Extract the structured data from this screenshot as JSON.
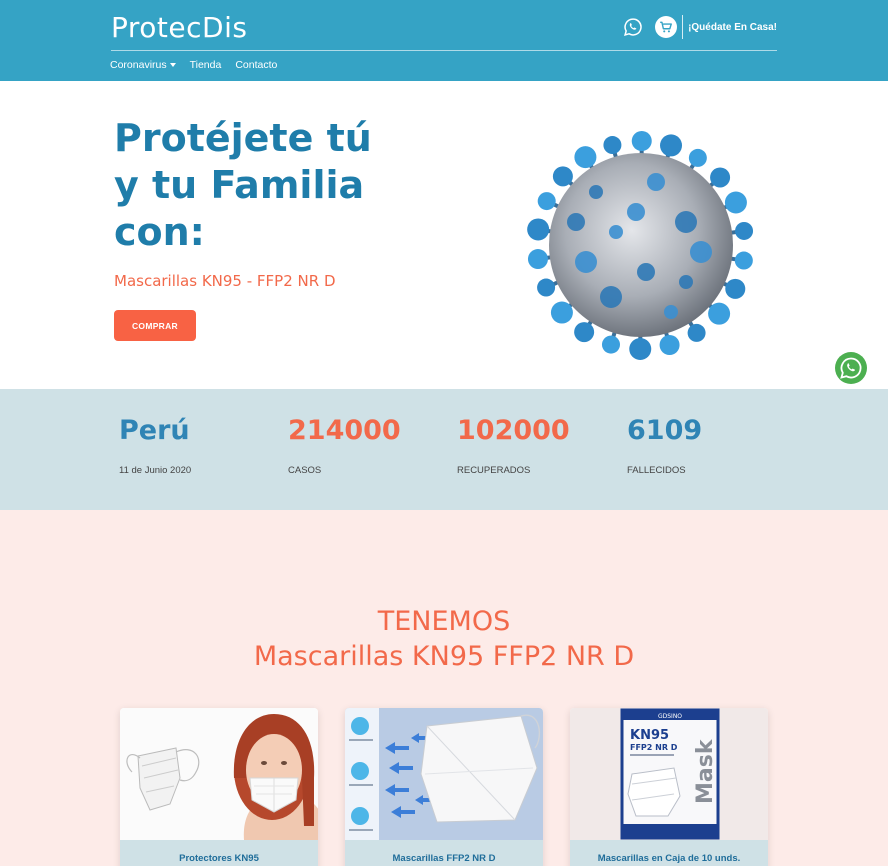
{
  "header": {
    "brand": "ProtecDis",
    "stay_home": "¡Quédate En Casa!",
    "nav": [
      "Coronavirus",
      "Tienda",
      "Contacto"
    ]
  },
  "hero": {
    "title_lines": [
      "Protéjete tú",
      "y tu Familia",
      "con:"
    ],
    "subtitle": "Mascarillas KN95 - FFP2 NR D",
    "button": "COMPRAR"
  },
  "stats": {
    "country": "Perú",
    "date": "11 de Junio 2020",
    "items": [
      {
        "value": "214000",
        "label": "CASOS"
      },
      {
        "value": "102000",
        "label": "RECUPERADOS"
      },
      {
        "value": "6109",
        "label": "FALLECIDOS"
      }
    ]
  },
  "products": {
    "title_lines": [
      "TENEMOS",
      "Mascarillas KN95 FFP2 NR D"
    ],
    "cards": [
      {
        "caption": "Protectores KN95"
      },
      {
        "caption": "Mascarillas FFP2 NR D"
      },
      {
        "caption": "Mascarillas en Caja de 10 unds.",
        "box": {
          "brand": "GDSINO",
          "model": "KN95",
          "type": "FFP2 NR D",
          "word": "Mask"
        }
      }
    ]
  },
  "colors": {
    "header": "#35a3c5",
    "primary_blue": "#1f7daa",
    "coral": "#f2694a",
    "stats_bg": "#cfe1e6",
    "products_bg": "#fdebe8",
    "whatsapp": "#4caf50"
  }
}
